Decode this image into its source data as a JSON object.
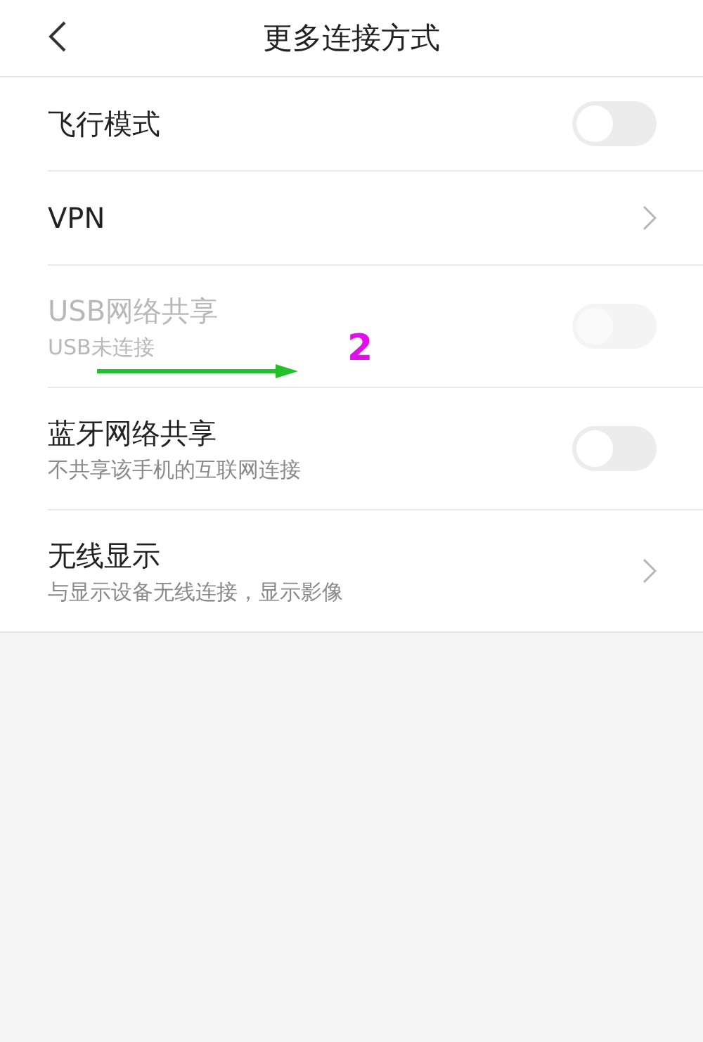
{
  "header": {
    "title": "更多连接方式"
  },
  "items": [
    {
      "kind": "toggle",
      "title": "飞行模式",
      "on": false,
      "disabled": false
    },
    {
      "kind": "link",
      "title": "VPN"
    },
    {
      "kind": "toggle",
      "title": "USB网络共享",
      "subtitle": "USB未连接",
      "on": false,
      "disabled": true,
      "annotation": "2"
    },
    {
      "kind": "toggle",
      "title": "蓝牙网络共享",
      "subtitle": "不共享该手机的互联网连接",
      "on": false,
      "disabled": false
    },
    {
      "kind": "link",
      "title": "无线显示",
      "subtitle": "与显示设备无线连接，显示影像"
    }
  ]
}
